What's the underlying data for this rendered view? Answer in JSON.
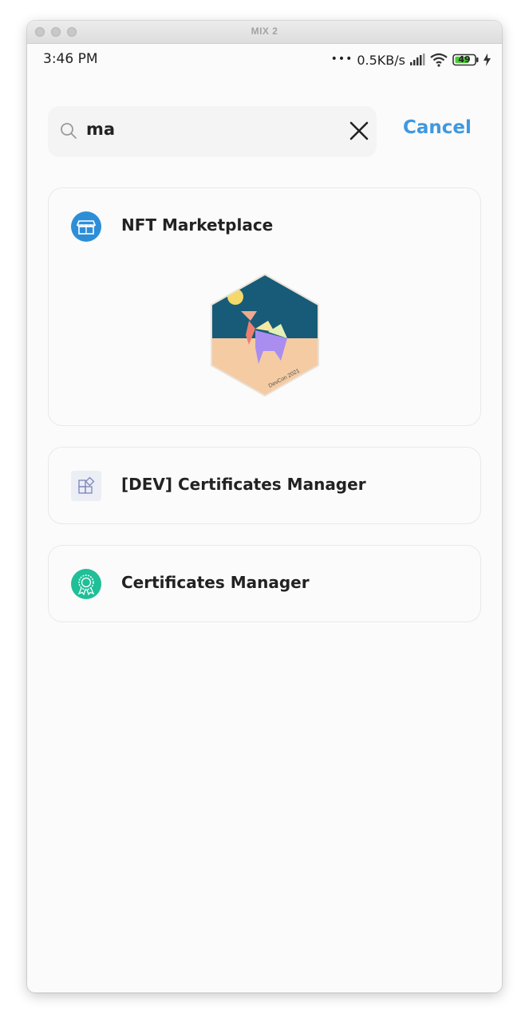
{
  "window": {
    "title": "MIX 2"
  },
  "statusbar": {
    "time": "3:46 PM",
    "network_rate": "0.5KB/s",
    "battery": "49"
  },
  "search": {
    "query": "ma",
    "cancel_label": "Cancel"
  },
  "results": [
    {
      "name": "NFT Marketplace",
      "icon": "storefront-icon",
      "preview_caption": "DevCon 2021"
    },
    {
      "name": "[DEV] Certificates Manager",
      "icon": "widgets-icon"
    },
    {
      "name": "Certificates Manager",
      "icon": "award-badge-icon"
    }
  ],
  "colors": {
    "accent": "#3f98e0",
    "nft_icon": "#2d8ed8",
    "cert_icon": "#1fbf98"
  }
}
